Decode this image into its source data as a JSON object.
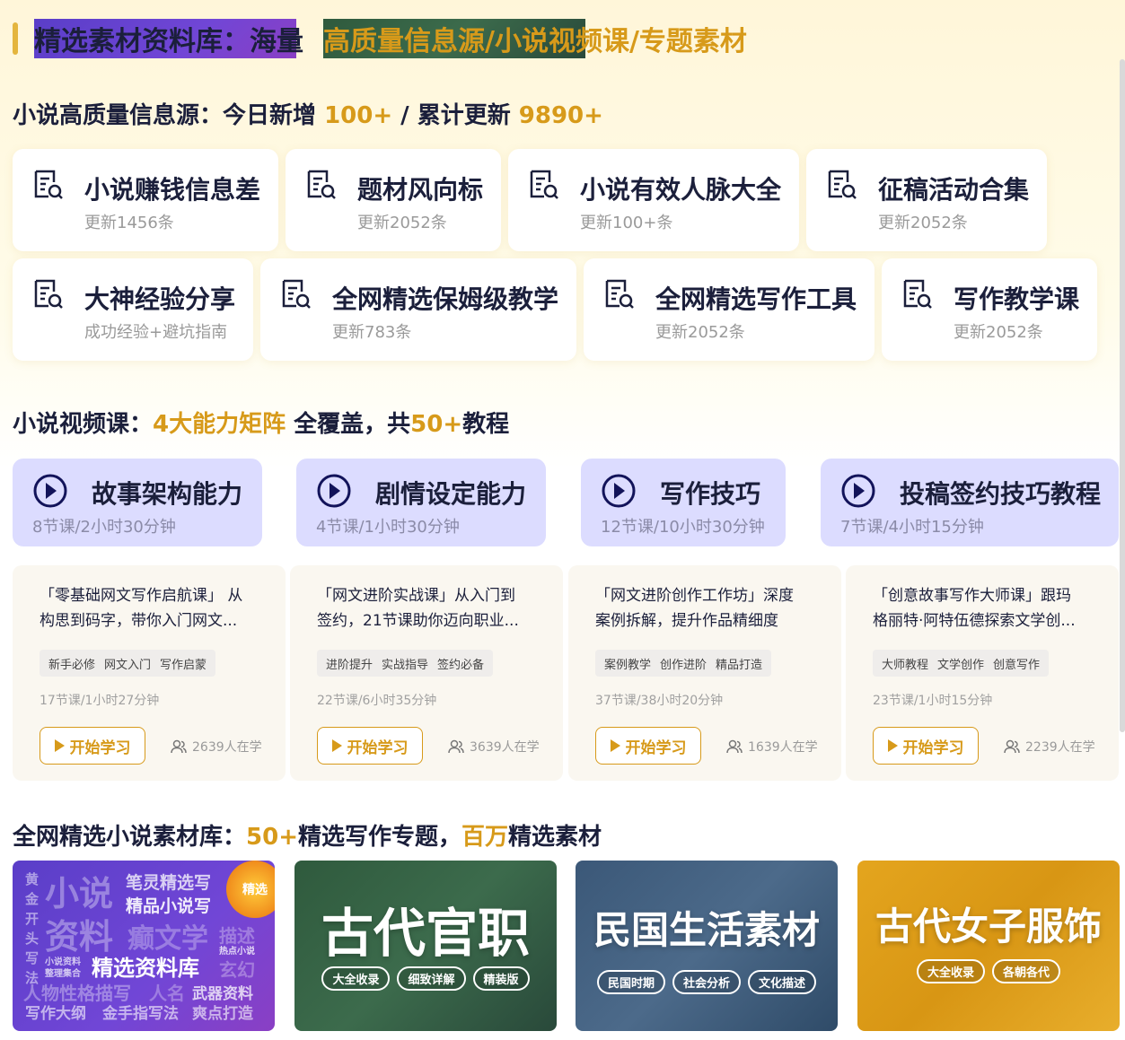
{
  "header": {
    "title": "精选素材资料库：海量",
    "highlight": "高质量信息源/小说视频课/专题素材"
  },
  "sources_section": {
    "title_prefix": "小说高质量信息源：今日新增 ",
    "today_new": "100+",
    "divider": " / 累计更新 ",
    "total": "9890+"
  },
  "sources": [
    {
      "title": "小说赚钱信息差",
      "sub": "更新1456条"
    },
    {
      "title": "题材风向标",
      "sub": "更新2052条"
    },
    {
      "title": "小说有效人脉大全",
      "sub": "更新100+条"
    },
    {
      "title": "征稿活动合集",
      "sub": "更新2052条"
    },
    {
      "title": "大神经验分享",
      "sub": "成功经验+避坑指南"
    },
    {
      "title": "全网精选保姆级教学",
      "sub": "更新783条"
    },
    {
      "title": "全网精选写作工具",
      "sub": "更新2052条"
    },
    {
      "title": "写作教学课",
      "sub": "更新2052条"
    }
  ],
  "video_section": {
    "prefix": "小说视频课：",
    "hl1": "4大能力矩阵",
    "mid": " 全覆盖，共",
    "hl2": "50+",
    "suffix": "教程"
  },
  "abilities": [
    {
      "title": "故事架构能力",
      "sub": "8节课/2小时30分钟"
    },
    {
      "title": "剧情设定能力",
      "sub": "4节课/1小时30分钟"
    },
    {
      "title": "写作技巧",
      "sub": "12节课/10小时30分钟"
    },
    {
      "title": "投稿签约技巧教程",
      "sub": "7节课/4小时15分钟"
    }
  ],
  "courses": [
    {
      "line1": "「零基础网文写作启航课」 从",
      "line2": "构思到码字，带你入门网文...",
      "tags": [
        "新手必修",
        "网文入门",
        "写作启蒙"
      ],
      "meta": "17节课/1小时27分钟",
      "button": "开始学习",
      "learners": "2639人在学"
    },
    {
      "line1": "「网文进阶实战课」从入门到",
      "line2": "签约，21节课助你迈向职业...",
      "tags": [
        "进阶提升",
        "实战指导",
        "签约必备"
      ],
      "meta": "22节课/6小时35分钟",
      "button": "开始学习",
      "learners": "3639人在学"
    },
    {
      "line1": "「网文进阶创作工作坊」深度",
      "line2": "案例拆解，提升作品精细度",
      "tags": [
        "案例教学",
        "创作进阶",
        "精品打造"
      ],
      "meta": "37节课/38小时20分钟",
      "button": "开始学习",
      "learners": "1639人在学"
    },
    {
      "line1": "「创意故事写作大师课」跟玛",
      "line2": "格丽特·阿特伍德探索文学创...",
      "tags": [
        "大师教程",
        "文学创作",
        "创意写作"
      ],
      "meta": "23节课/1小时15分钟",
      "button": "开始学习",
      "learners": "2239人在学"
    }
  ],
  "material_section": {
    "prefix": "全网精选小说素材库：",
    "hl1": "50+",
    "mid": "精选写作专题，",
    "hl2": "百万",
    "suffix": "精选素材"
  },
  "tiles": [
    {
      "main": "精选资料库",
      "badge": "精选",
      "words": [
        "小说",
        "资料",
        "笔灵精选写",
        "精品小说写",
        "癫文学",
        "描述",
        "黄",
        "金",
        "开",
        "头",
        "写",
        "法",
        "小说资料",
        "整理集合",
        "热点小说",
        "玄幻",
        "人物性格描写",
        "人名",
        "武器资料",
        "写作大纲",
        "金手指写法",
        "爽点打造"
      ]
    },
    {
      "title": "古代官职",
      "pills": [
        "大全收录",
        "细致详解",
        "精装版"
      ]
    },
    {
      "title": "民国生活素材",
      "pills": [
        "民国时期",
        "社会分析",
        "文化描述"
      ]
    },
    {
      "title": "古代女子服饰",
      "pills": [
        "大全收录",
        "各朝各代"
      ]
    }
  ],
  "colors": {
    "accent": "#d79a1a",
    "dark": "#1b1f3b",
    "ability_bg": "#dcdcff"
  }
}
